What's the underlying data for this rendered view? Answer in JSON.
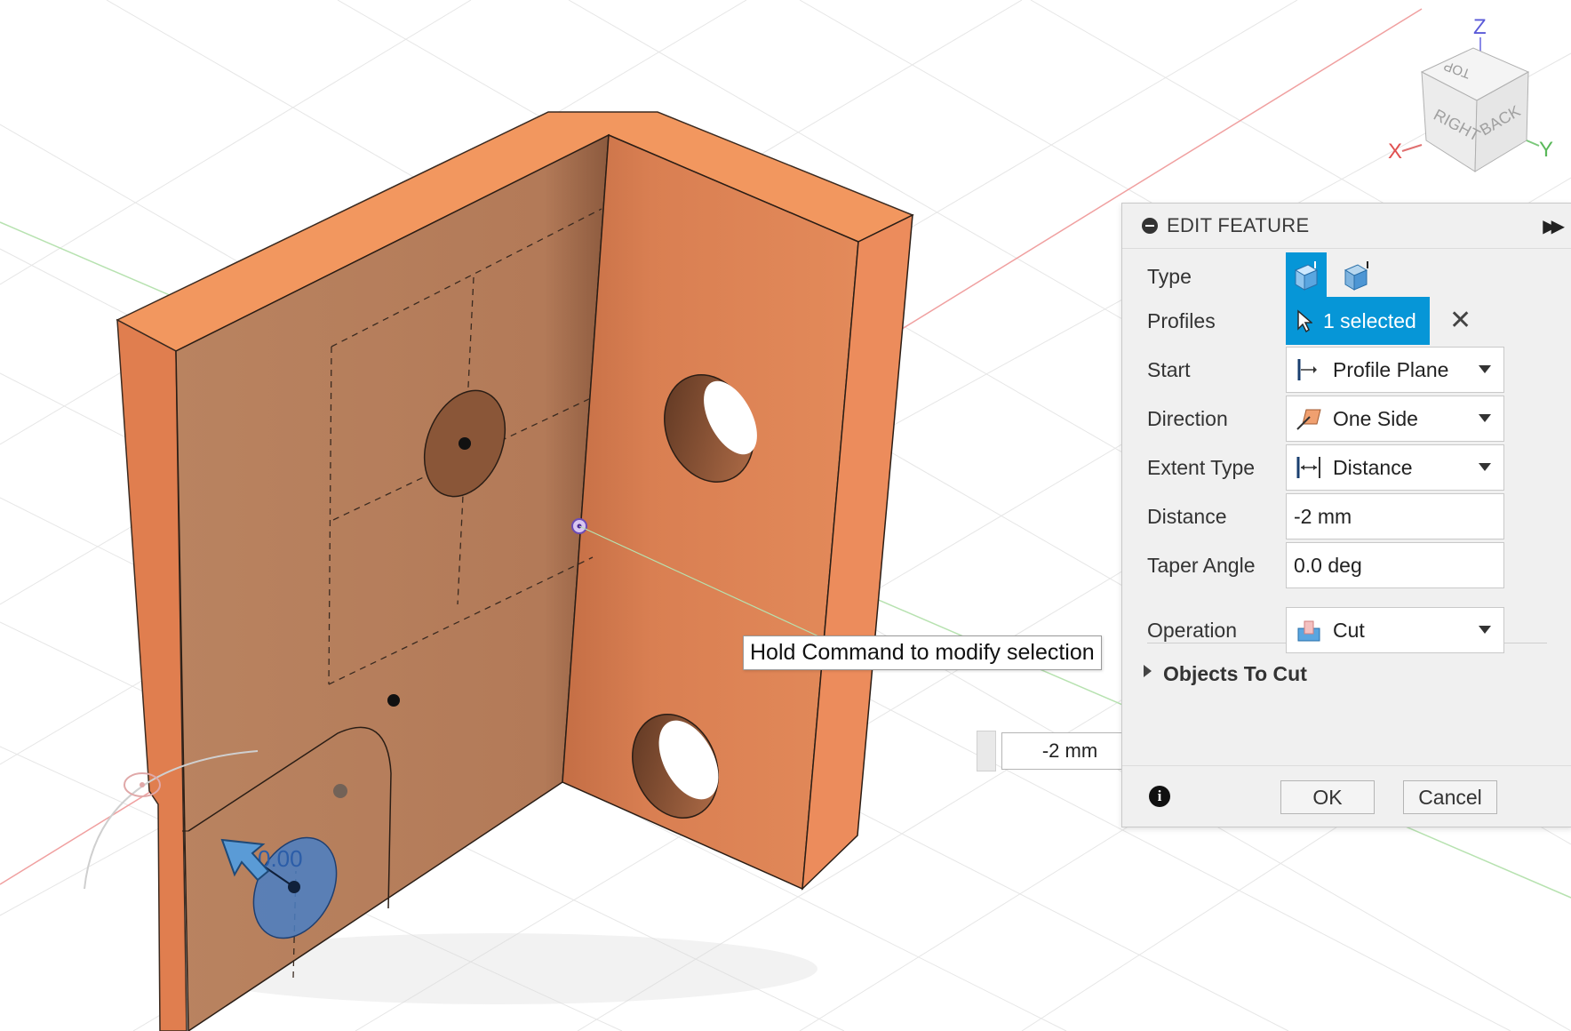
{
  "panel": {
    "title": "EDIT FEATURE",
    "rows": {
      "type_label": "Type",
      "profiles_label": "Profiles",
      "profiles_value": "1 selected",
      "start_label": "Start",
      "start_value": "Profile Plane",
      "direction_label": "Direction",
      "direction_value": "One Side",
      "extent_label": "Extent Type",
      "extent_value": "Distance",
      "distance_label": "Distance",
      "distance_value": "-2 mm",
      "taper_label": "Taper Angle",
      "taper_value": "0.0 deg",
      "operation_label": "Operation",
      "operation_value": "Cut",
      "objects_label": "Objects To Cut"
    },
    "ok_label": "OK",
    "cancel_label": "Cancel"
  },
  "tooltip": "Hold Command to modify selection",
  "manipulator": {
    "distance_value": "-2 mm",
    "angle_value": "0.00"
  },
  "viewcube": {
    "top": "TOP",
    "right": "RIGHT",
    "back": "BACK",
    "axis_x": "X",
    "axis_y": "Y",
    "axis_z": "Z"
  },
  "colors": {
    "accent": "#0696d7",
    "part": "#e8875a",
    "part_top": "#f2975f",
    "selection": "#4a7fc4"
  }
}
